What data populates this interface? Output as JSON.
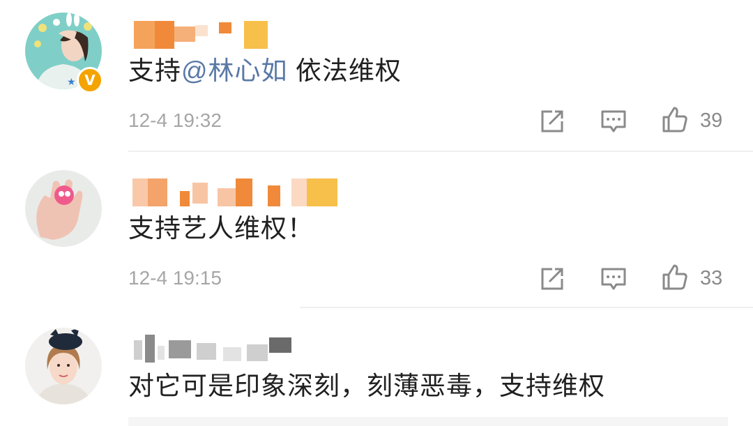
{
  "comments": [
    {
      "verified_badge": "V",
      "content_mention": "@林心如",
      "content_rest": " 依法维权",
      "content_prefix": "支持",
      "time": "12-4 19:32",
      "likes": "39"
    },
    {
      "content_prefix": "支持艺人维权！",
      "time": "12-4 19:15",
      "likes": "33"
    },
    {
      "content_prefix": "对它可是印象深刻，刻薄恶毒，支持维权"
    }
  ],
  "icons": {
    "share": "share-icon",
    "comment": "comment-icon",
    "like": "thumbs-up-icon"
  },
  "colors": {
    "mention": "#5a78a6",
    "text": "#202020",
    "meta": "#a6a6a6",
    "badge": "#f4a300"
  }
}
